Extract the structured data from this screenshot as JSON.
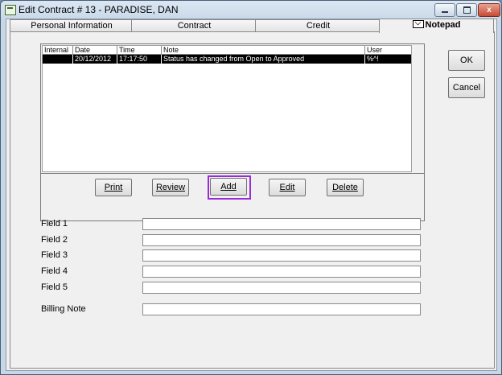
{
  "window": {
    "title": "Edit Contract # 13 - PARADISE, DAN",
    "minimize": "–",
    "maximize": "□",
    "close": "x"
  },
  "tabs": [
    {
      "label": "Personal Information"
    },
    {
      "label": "Contract"
    },
    {
      "label": "Credit"
    },
    {
      "label": "Notepad",
      "icon": "envelope-icon",
      "active": true
    }
  ],
  "notes_grid": {
    "columns": [
      "Internal",
      "Date",
      "Time",
      "Note",
      "User"
    ],
    "rows": [
      {
        "internal": "",
        "date": "20/12/2012",
        "time": "17:17:50",
        "note": "Status has changed from Open to Approved",
        "user": "%^!"
      }
    ]
  },
  "note_buttons": {
    "print": "Print",
    "review": "Review",
    "add": "Add",
    "edit": "Edit",
    "delete": "Delete"
  },
  "dialog_buttons": {
    "ok": "OK",
    "cancel": "Cancel"
  },
  "fields": [
    {
      "label": "Field 1",
      "value": ""
    },
    {
      "label": "Field 2",
      "value": ""
    },
    {
      "label": "Field 3",
      "value": ""
    },
    {
      "label": "Field 4",
      "value": ""
    },
    {
      "label": "Field 5",
      "value": ""
    },
    {
      "label": "Billing Note",
      "value": ""
    }
  ],
  "colors": {
    "highlight": "#9a2bdc",
    "selected_row": "#000000"
  }
}
